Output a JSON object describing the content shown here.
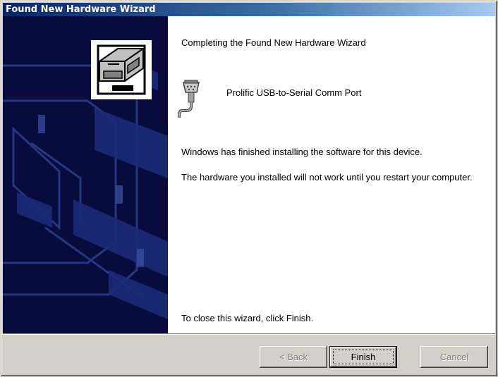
{
  "window": {
    "title": "Found New Hardware Wizard"
  },
  "wizard": {
    "heading": "Completing the Found New Hardware Wizard",
    "device": {
      "name": "Prolific USB-to-Serial Comm Port",
      "icon": "serial-port-icon"
    },
    "message_finished": "Windows has finished installing the software for this device.",
    "message_restart": "The hardware you installed will not work until you restart your computer.",
    "close_instruction": "To close this wizard, click Finish.",
    "side_icon": "hardware-box-icon"
  },
  "buttons": {
    "back_label": "< Back",
    "finish_label": "Finish",
    "cancel_label": "Cancel",
    "back_enabled": false,
    "finish_enabled": true,
    "cancel_enabled": false
  },
  "colors": {
    "title_gradient_start": "#0a246a",
    "title_gradient_end": "#a6caf0",
    "side_panel": "#080c3c",
    "dialog_face": "#d4d0c8"
  }
}
